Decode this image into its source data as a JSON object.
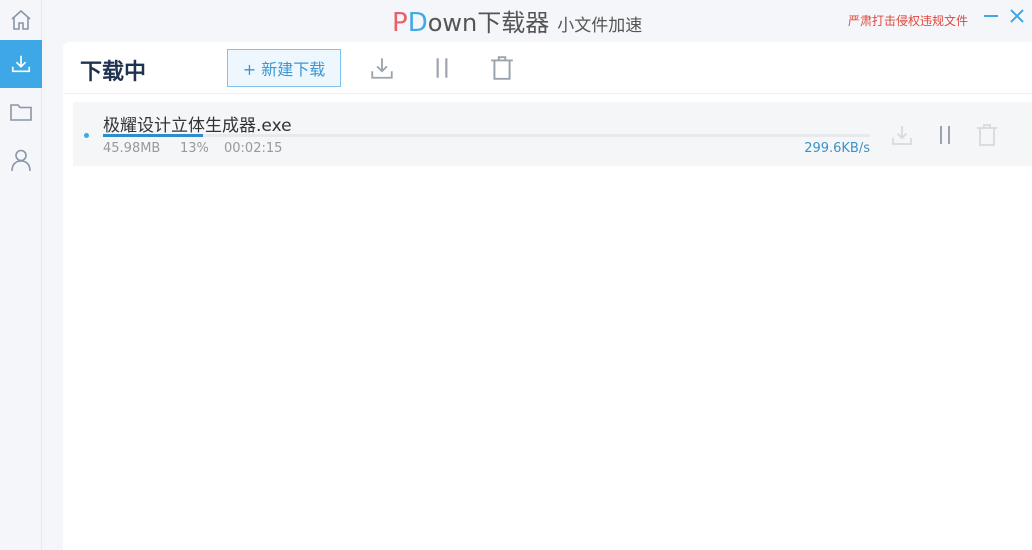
{
  "title_bar": {
    "logo_p": "P",
    "logo_d": "D",
    "logo_rest": "own下载器",
    "slogan": "小文件加速",
    "warning": "严肃打击侵权违规文件"
  },
  "sidebar": {
    "items": [
      {
        "icon": "home-icon"
      },
      {
        "icon": "download-icon",
        "active": true
      },
      {
        "icon": "folder-icon"
      },
      {
        "icon": "user-icon"
      }
    ]
  },
  "toolbar": {
    "title": "下载中",
    "new_download_label": "+ 新建下载",
    "icons": [
      "download-icon",
      "pause-icon",
      "trash-icon"
    ]
  },
  "downloads": [
    {
      "filename": "极耀设计立体生成器.exe",
      "size": "45.98MB",
      "percent": "13%",
      "progress": 0.13,
      "elapsed": "00:02:15",
      "speed": "299.6KB/s"
    }
  ],
  "colors": {
    "accent": "#3ea8e6",
    "logo_p": "#e8616a",
    "logo_d": "#41a9e3",
    "warning": "#e0463c",
    "progress": "#2f8dcc"
  }
}
